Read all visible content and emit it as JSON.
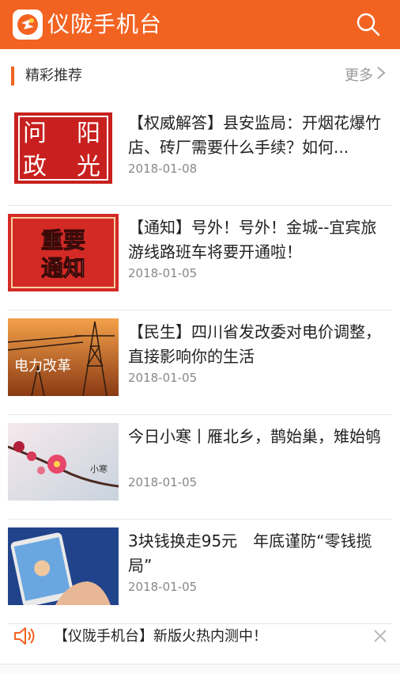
{
  "header": {
    "app_title": "仪陇手机台"
  },
  "section": {
    "title": "精彩推荐",
    "more_label": "更多"
  },
  "news": [
    {
      "thumb": "stamp-seal-image",
      "title": "【权威解答】县安监局：开烟花爆竹店、砖厂需要什么手续？如何...",
      "date": "2018-01-08",
      "thumb_text": [
        "问",
        "阳",
        "政",
        "光"
      ]
    },
    {
      "thumb": "notice-banner-image",
      "title": "【通知】号外！号外！金城--宜宾旅游线路班车将要开通啦！",
      "date": "2018-01-05",
      "thumb_text": [
        "重要",
        "通知"
      ]
    },
    {
      "thumb": "power-tower-image",
      "title": "【民生】四川省发改委对电价调整，直接影响你的生活",
      "date": "2018-01-05",
      "thumb_text": [
        "电力改革"
      ]
    },
    {
      "thumb": "plum-blossom-image",
      "title": "今日小寒丨雁北乡，鹊始巢，雉始鸲",
      "date": "2018-01-05",
      "thumb_text": [
        "小寒"
      ]
    },
    {
      "thumb": "phone-in-hand-image",
      "title": "3块钱换走95元　年底谨防“零钱揽局”",
      "date": "2018-01-05"
    }
  ],
  "notice": {
    "text": "【仪陇手机台】新版火热内测中！",
    "icon": "speaker-icon"
  },
  "colors": {
    "brand": "#f26322",
    "dark_red": "#c8201e"
  }
}
